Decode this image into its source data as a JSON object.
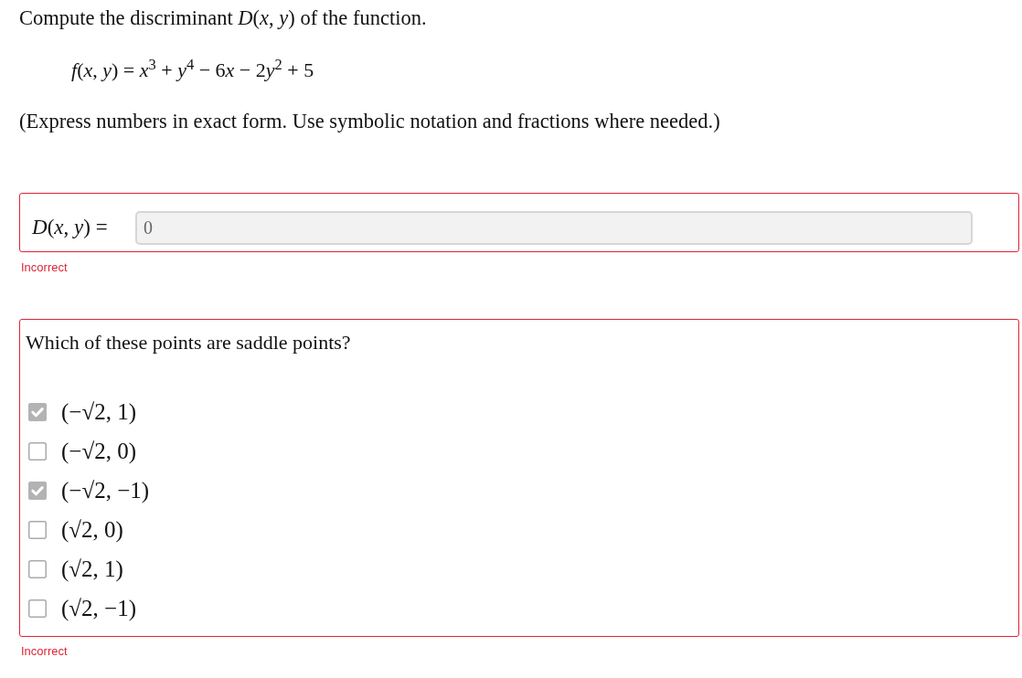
{
  "question": {
    "intro": "Compute the discriminant *D*(*x*, *y*) of the function.",
    "formula": [
      "*f*(*x*, *y*) = *x*$^{3}$ + *y*$^{4}$ − 6",
      "*x* − 2",
      "*y*$^{2}$ + 5"
    ],
    "note": "(Express numbers in exact form. Use symbolic notation and fractions where needed.)"
  },
  "parts": [
    {
      "kind": "input",
      "correct": false,
      "label": "*D*(*x*, *y*) =",
      "value": "0",
      "feedback": "Incorrect"
    },
    {
      "kind": "checklist",
      "correct": false,
      "prompt": "Which of these points are saddle points?",
      "options": [
        {
          "label": "(−√2, 1)",
          "checked": true
        },
        {
          "label": "(−√2, 0)",
          "checked": false
        },
        {
          "label": "(−√2, −1)",
          "checked": true
        },
        {
          "label": "(√2, 0)",
          "checked": false
        },
        {
          "label": "(√2, 1)",
          "checked": false
        },
        {
          "label": "(√2, −1)",
          "checked": false
        }
      ],
      "feedback": "Incorrect"
    }
  ]
}
